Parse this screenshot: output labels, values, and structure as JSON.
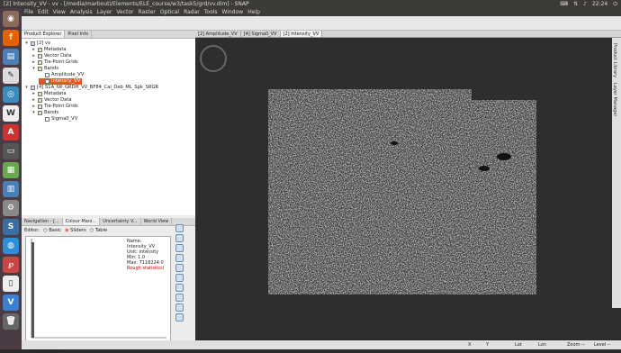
{
  "window": {
    "title": "[2] Intensity_VV - vv - [/media/marbouti/Elements/ELE_course/w3/task5/grd/vv.dim] - SNAP",
    "time": "22:24"
  },
  "menu": [
    "File",
    "Edit",
    "View",
    "Analysis",
    "Layer",
    "Vector",
    "Raster",
    "Optical",
    "Radar",
    "Tools",
    "Window",
    "Help"
  ],
  "left_tabs": {
    "product_explorer": "Product Explorer",
    "pixel_info": "Pixel Info"
  },
  "tree": [
    {
      "label": "[2] vv",
      "level": 0,
      "type": "product",
      "expanded": true
    },
    {
      "label": "Metadata",
      "level": 1,
      "type": "folder",
      "expanded": false
    },
    {
      "label": "Vector Data",
      "level": 1,
      "type": "folder",
      "expanded": false
    },
    {
      "label": "Tie-Point Grids",
      "level": 1,
      "type": "folder",
      "expanded": false
    },
    {
      "label": "Bands",
      "level": 1,
      "type": "folder",
      "expanded": true
    },
    {
      "label": "Amplitude_VV",
      "level": 2,
      "type": "band",
      "selected": false
    },
    {
      "label": "Intensity_VV",
      "level": 2,
      "type": "band",
      "selected": true
    },
    {
      "label": "[4] S1A_IW_GRDH_VV_BF84_Cal_Deb_ML_Spk_SRGR",
      "level": 0,
      "type": "product",
      "expanded": true
    },
    {
      "label": "Metadata",
      "level": 1,
      "type": "folder",
      "expanded": false
    },
    {
      "label": "Vector Data",
      "level": 1,
      "type": "folder",
      "expanded": false
    },
    {
      "label": "Tie-Point Grids",
      "level": 1,
      "type": "folder",
      "expanded": false
    },
    {
      "label": "Bands",
      "level": 1,
      "type": "folder",
      "expanded": true
    },
    {
      "label": "Sigma0_VV",
      "level": 2,
      "type": "band",
      "selected": false
    }
  ],
  "bottom_tabs": [
    "Navigation - [...",
    "Colour Mani...",
    "Uncertainty V...",
    "World View"
  ],
  "editor": {
    "label": "Editor:",
    "options": [
      "Basic",
      "Sliders",
      "Table"
    ],
    "selected": "Sliders"
  },
  "stats": {
    "name": "Name: Intensity_VV",
    "unit": "Unit: intensity",
    "min": "Min: 1.0",
    "max": "Max: 7118224.0",
    "warning": "Rough statistics!"
  },
  "more_options": "More Options",
  "doc_tabs": [
    {
      "label": "[2] Amplitude_VV",
      "active": false
    },
    {
      "label": "[4] Sigma0_VV",
      "active": false
    },
    {
      "label": "[2] Intensity_VV",
      "active": true
    }
  ],
  "right_strip": [
    "Product Library",
    "Layer Manager"
  ],
  "status": {
    "x": "X",
    "y": "Y",
    "lat": "Lat",
    "lon": "Lon",
    "zoom": "Zoom --",
    "level": "Level --"
  },
  "histogram": {
    "value_fraction": 0.97
  },
  "colors": {
    "accent": "#e95420",
    "launcher": "#4a3b45",
    "titlebar": "#3c3b37",
    "panel": "#ececec",
    "view_bg": "#2e2e2e"
  }
}
